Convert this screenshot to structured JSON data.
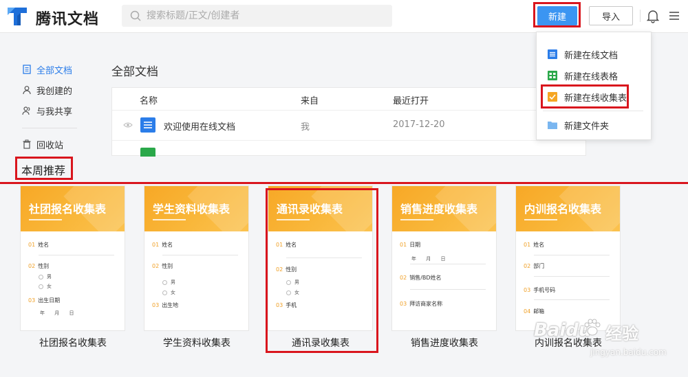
{
  "app": {
    "name": "腾讯文档"
  },
  "search": {
    "placeholder": "搜索标题/正文/创建者"
  },
  "toolbar": {
    "new_label": "新建",
    "import_label": "导入"
  },
  "sidebar": {
    "items": [
      {
        "label": "全部文档",
        "icon": "document-list-icon",
        "active": true
      },
      {
        "label": "我创建的",
        "icon": "user-icon"
      },
      {
        "label": "与我共享",
        "icon": "shared-users-icon"
      }
    ],
    "trash": {
      "label": "回收站",
      "icon": "trash-icon"
    }
  },
  "main": {
    "title": "全部文档",
    "columns": [
      "名称",
      "来自",
      "最近打开"
    ],
    "rows": [
      {
        "name": "欢迎使用在线文档",
        "from": "我",
        "opened": "2017-12-20"
      }
    ]
  },
  "dropdown": {
    "items": [
      {
        "label": "新建在线文档",
        "icon": "online-doc-icon",
        "color": "#2b7de9"
      },
      {
        "label": "新建在线表格",
        "icon": "online-sheet-icon",
        "color": "#2aa84a"
      },
      {
        "label": "新建在线收集表",
        "icon": "collect-form-icon",
        "color": "#f5a623"
      },
      {
        "label": "新建文件夹",
        "icon": "folder-icon",
        "color": "#7ab6f0"
      }
    ]
  },
  "recommend": {
    "title": "本周推荐",
    "cards": [
      {
        "title": "社团报名收集表",
        "label": "社团报名收集表",
        "fields": [
          {
            "no": "01",
            "name": "姓名"
          },
          {
            "no": "02",
            "name": "性别",
            "options": [
              "男",
              "女"
            ]
          },
          {
            "no": "03",
            "name": "出生日期",
            "date": "年 月 日"
          }
        ]
      },
      {
        "title": "学生资料收集表",
        "label": "学生资料收集表",
        "fields": [
          {
            "no": "01",
            "name": "姓名"
          },
          {
            "no": "02",
            "name": "性别",
            "options": [
              "男",
              "女"
            ]
          },
          {
            "no": "03",
            "name": "出生地"
          }
        ]
      },
      {
        "title": "通讯录收集表",
        "label": "通讯录收集表",
        "fields": [
          {
            "no": "01",
            "name": "姓名"
          },
          {
            "no": "02",
            "name": "性别",
            "options": [
              "男",
              "女"
            ]
          },
          {
            "no": "03",
            "name": "手机"
          }
        ]
      },
      {
        "title": "销售进度收集表",
        "label": "销售进度收集表",
        "fields": [
          {
            "no": "01",
            "name": "日期",
            "date": "年 月 日"
          },
          {
            "no": "02",
            "name": "销售/BD姓名"
          },
          {
            "no": "03",
            "name": "拜访商家名称"
          }
        ]
      },
      {
        "title": "内训报名收集表",
        "label": "内训报名收集表",
        "fields": [
          {
            "no": "01",
            "name": "姓名"
          },
          {
            "no": "02",
            "name": "部门"
          },
          {
            "no": "03",
            "name": "手机号码"
          },
          {
            "no": "04",
            "name": "邮箱"
          }
        ]
      }
    ]
  },
  "watermark": {
    "brand": "Baidu",
    "text": "经验",
    "url": "jingyan.baidu.com"
  },
  "colors": {
    "accent": "#3b95f2",
    "highlight": "#d9151d",
    "card_orange": "#f7a826"
  }
}
